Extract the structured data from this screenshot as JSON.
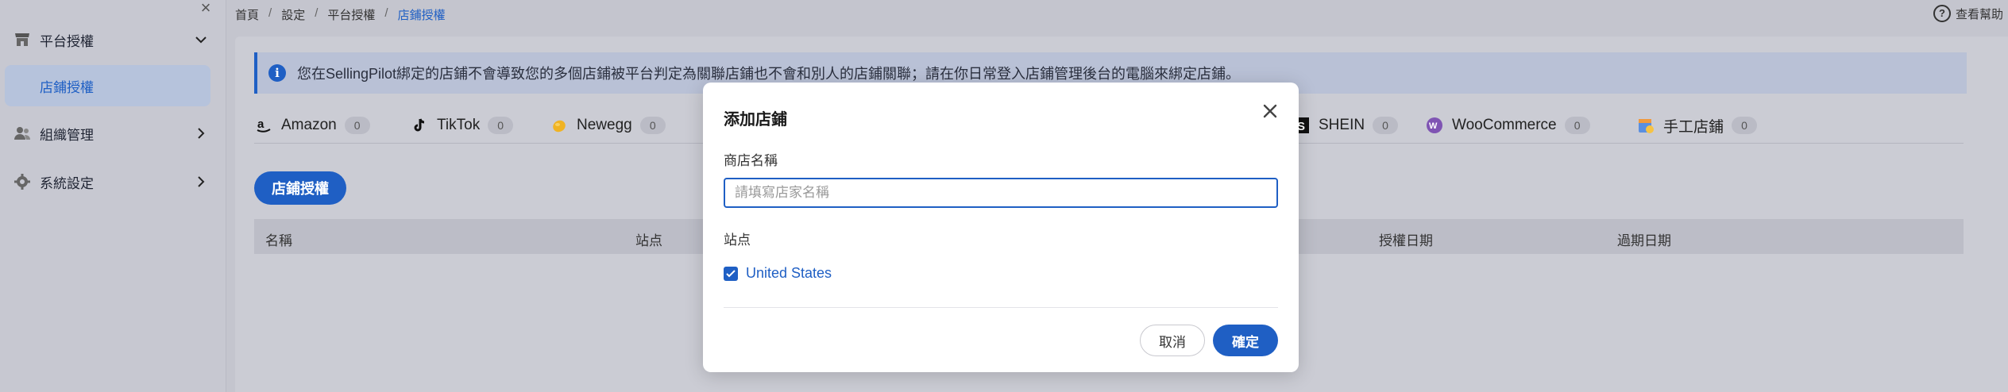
{
  "sidebar": {
    "items": [
      {
        "label": "平台授權",
        "icon": "store-icon"
      },
      {
        "label": "組織管理",
        "icon": "users-icon"
      },
      {
        "label": "系統設定",
        "icon": "gear-icon"
      }
    ],
    "sub_item": "店鋪授權"
  },
  "breadcrumb": [
    "首頁",
    "設定",
    "平台授權",
    "店鋪授權"
  ],
  "help_label": "查看幫助",
  "notice_text": "您在SellingPilot綁定的店鋪不會導致您的多個店鋪被平台判定為關聯店鋪也不會和別人的店鋪關聯；請在你日常登入店鋪管理後台的電腦來綁定店鋪。",
  "tabs": [
    {
      "label": "Amazon",
      "count": "0"
    },
    {
      "label": "TikTok",
      "count": "0"
    },
    {
      "label": "Newegg",
      "count": "0"
    },
    {
      "label": "SHEIN",
      "count": "0"
    },
    {
      "label": "WooCommerce",
      "count": "0"
    },
    {
      "label": "手工店鋪",
      "count": "0"
    }
  ],
  "auth_button": "店鋪授權",
  "table_headers": [
    "名稱",
    "站点",
    "授權日期",
    "過期日期"
  ],
  "modal": {
    "title": "添加店鋪",
    "store_name_label": "商店名稱",
    "store_name_placeholder": "請填寫店家名稱",
    "site_label": "站点",
    "site_option": "United States",
    "site_checked": true,
    "cancel_label": "取消",
    "confirm_label": "確定"
  },
  "colors": {
    "accent": "#1f5fc4",
    "overlay": "#c4c5ce"
  }
}
